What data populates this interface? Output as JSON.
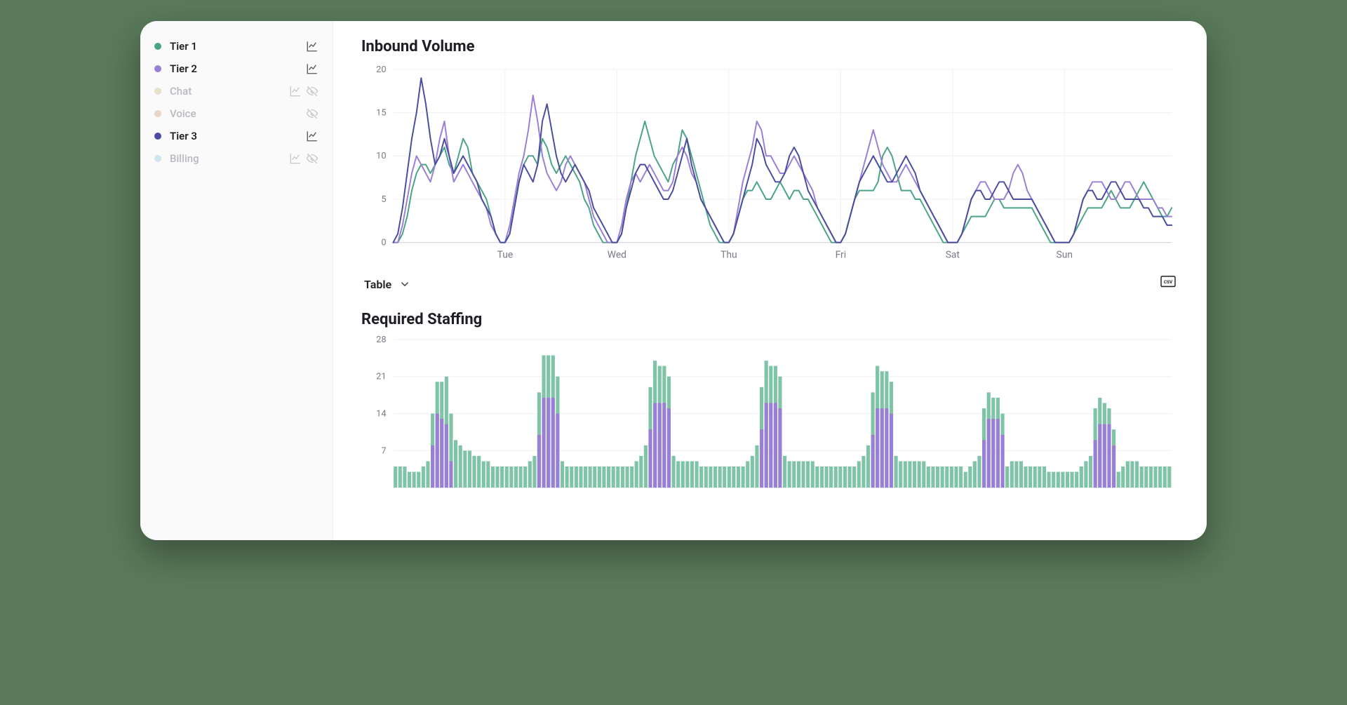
{
  "sidebar": {
    "items": [
      {
        "label": "Tier 1",
        "color": "#4aa38a",
        "active": true,
        "chart_icon": true,
        "hide_icon": false
      },
      {
        "label": "Tier 2",
        "color": "#9a7fd6",
        "active": true,
        "chart_icon": true,
        "hide_icon": false
      },
      {
        "label": "Chat",
        "color": "#e8e0c8",
        "active": false,
        "chart_icon": true,
        "hide_icon": true
      },
      {
        "label": "Voice",
        "color": "#e8d6c8",
        "active": false,
        "chart_icon": false,
        "hide_icon": true
      },
      {
        "label": "Tier 3",
        "color": "#4a4d9e",
        "active": true,
        "chart_icon": true,
        "hide_icon": false
      },
      {
        "label": "Billing",
        "color": "#cfe5ef",
        "active": false,
        "chart_icon": true,
        "hide_icon": true
      }
    ]
  },
  "toolbar": {
    "table_label": "Table"
  },
  "chart_data": [
    {
      "id": "inbound",
      "type": "line",
      "title": "Inbound Volume",
      "ylabel": "",
      "xlabel": "",
      "ylim": [
        0,
        20
      ],
      "yticks": [
        0,
        5,
        10,
        15,
        20
      ],
      "x_tick_labels": [
        "Tue",
        "Wed",
        "Thu",
        "Fri",
        "Sat",
        "Sun"
      ],
      "x_tick_positions": [
        24,
        48,
        72,
        96,
        120,
        144
      ],
      "n_points": 168,
      "series": [
        {
          "name": "Tier 1",
          "color": "#4aa38a",
          "values": [
            0,
            0,
            1,
            3,
            6,
            8,
            9,
            9,
            8,
            9,
            10,
            11,
            9,
            8,
            10,
            12,
            11,
            8,
            7,
            6,
            5,
            3,
            1,
            0,
            0,
            1,
            4,
            7,
            9,
            10,
            10,
            9,
            12,
            11,
            9,
            8,
            9,
            10,
            9,
            8,
            7,
            5,
            4,
            2,
            1,
            0,
            0,
            0,
            0,
            1,
            4,
            7,
            10,
            12,
            14,
            12,
            10,
            9,
            8,
            7,
            9,
            10,
            13,
            12,
            10,
            8,
            6,
            4,
            2,
            1,
            0,
            0,
            0,
            1,
            3,
            5,
            6,
            6,
            7,
            6,
            5,
            5,
            6,
            7,
            6,
            5,
            6,
            6,
            5,
            5,
            4,
            3,
            2,
            1,
            0,
            0,
            0,
            1,
            3,
            5,
            6,
            6,
            6,
            6,
            7,
            10,
            11,
            10,
            8,
            6,
            6,
            6,
            5,
            5,
            4,
            3,
            2,
            1,
            0,
            0,
            0,
            0,
            1,
            2,
            3,
            3,
            3,
            3,
            4,
            5,
            5,
            4,
            4,
            4,
            4,
            4,
            4,
            4,
            3,
            2,
            1,
            0,
            0,
            0,
            0,
            0,
            1,
            2,
            3,
            4,
            4,
            4,
            4,
            5,
            6,
            5,
            4,
            4,
            4,
            5,
            6,
            7,
            6,
            5,
            4,
            3,
            3,
            4
          ]
        },
        {
          "name": "Tier 2",
          "color": "#9a7fd6",
          "values": [
            0,
            0,
            2,
            5,
            8,
            10,
            9,
            8,
            7,
            9,
            12,
            14,
            10,
            7,
            8,
            9,
            8,
            7,
            6,
            5,
            4,
            2,
            1,
            0,
            0,
            2,
            5,
            8,
            10,
            13,
            17,
            14,
            10,
            8,
            7,
            6,
            7,
            9,
            10,
            9,
            8,
            7,
            5,
            3,
            2,
            1,
            0,
            0,
            0,
            2,
            5,
            7,
            8,
            7,
            8,
            9,
            8,
            7,
            6,
            6,
            7,
            10,
            11,
            10,
            8,
            7,
            5,
            4,
            3,
            2,
            1,
            0,
            0,
            1,
            4,
            7,
            9,
            11,
            14,
            13,
            10,
            10,
            9,
            8,
            8,
            9,
            10,
            9,
            8,
            7,
            6,
            4,
            3,
            2,
            1,
            0,
            0,
            1,
            3,
            5,
            7,
            9,
            11,
            13,
            11,
            9,
            8,
            7,
            7,
            8,
            9,
            8,
            7,
            6,
            5,
            4,
            3,
            2,
            1,
            0,
            0,
            0,
            1,
            3,
            5,
            6,
            7,
            7,
            6,
            5,
            5,
            5,
            6,
            8,
            9,
            8,
            6,
            5,
            4,
            3,
            2,
            1,
            0,
            0,
            0,
            0,
            1,
            3,
            5,
            6,
            7,
            7,
            7,
            6,
            5,
            5,
            6,
            7,
            7,
            6,
            5,
            5,
            5,
            5,
            4,
            4,
            3,
            3
          ]
        },
        {
          "name": "Tier 3",
          "color": "#4a4d9e",
          "values": [
            0,
            1,
            4,
            8,
            12,
            15,
            19,
            16,
            12,
            9,
            10,
            12,
            10,
            8,
            9,
            10,
            9,
            8,
            7,
            5,
            4,
            3,
            1,
            0,
            0,
            1,
            4,
            7,
            9,
            8,
            7,
            9,
            14,
            16,
            13,
            10,
            8,
            7,
            8,
            9,
            8,
            7,
            6,
            4,
            3,
            2,
            1,
            0,
            0,
            1,
            4,
            6,
            8,
            9,
            9,
            8,
            7,
            6,
            5,
            5,
            6,
            8,
            10,
            12,
            9,
            7,
            5,
            4,
            3,
            2,
            1,
            0,
            0,
            1,
            3,
            5,
            7,
            9,
            12,
            11,
            9,
            8,
            7,
            7,
            8,
            10,
            11,
            10,
            8,
            6,
            5,
            4,
            3,
            2,
            1,
            0,
            0,
            1,
            3,
            5,
            7,
            8,
            9,
            10,
            9,
            8,
            7,
            7,
            8,
            9,
            10,
            9,
            8,
            6,
            5,
            4,
            3,
            2,
            1,
            0,
            0,
            0,
            1,
            3,
            5,
            6,
            6,
            5,
            5,
            6,
            7,
            7,
            6,
            5,
            5,
            5,
            5,
            5,
            4,
            3,
            2,
            1,
            0,
            0,
            0,
            0,
            1,
            3,
            5,
            6,
            6,
            5,
            5,
            6,
            7,
            7,
            6,
            5,
            5,
            5,
            5,
            4,
            4,
            3,
            3,
            3,
            2,
            2
          ]
        }
      ]
    },
    {
      "id": "staffing",
      "type": "bar",
      "title": "Required Staffing",
      "ylabel": "",
      "xlabel": "",
      "ylim": [
        0,
        28
      ],
      "yticks": [
        7,
        14,
        21,
        28
      ],
      "n_points": 168,
      "series": [
        {
          "name": "Tier 1",
          "color": "#7fc4a6",
          "values": [
            4,
            4,
            4,
            3,
            3,
            3,
            4,
            5,
            6,
            6,
            7,
            9,
            9,
            9,
            8,
            7,
            7,
            6,
            6,
            5,
            5,
            4,
            4,
            4,
            4,
            4,
            4,
            4,
            4,
            5,
            6,
            8,
            8,
            8,
            8,
            7,
            5,
            4,
            4,
            4,
            4,
            4,
            4,
            4,
            4,
            4,
            4,
            4,
            4,
            4,
            4,
            4,
            5,
            6,
            8,
            8,
            8,
            7,
            7,
            6,
            6,
            5,
            5,
            5,
            5,
            5,
            4,
            4,
            4,
            4,
            4,
            4,
            4,
            4,
            4,
            4,
            5,
            6,
            8,
            8,
            8,
            7,
            7,
            6,
            6,
            5,
            5,
            5,
            5,
            5,
            5,
            4,
            4,
            4,
            4,
            4,
            4,
            4,
            4,
            4,
            5,
            6,
            8,
            8,
            8,
            7,
            7,
            6,
            6,
            5,
            5,
            5,
            5,
            5,
            5,
            4,
            4,
            4,
            4,
            4,
            4,
            4,
            4,
            3,
            4,
            5,
            6,
            6,
            5,
            4,
            4,
            4,
            4,
            5,
            5,
            5,
            4,
            4,
            4,
            4,
            4,
            3,
            3,
            3,
            3,
            3,
            3,
            3,
            4,
            5,
            6,
            6,
            5,
            4,
            3,
            3,
            3,
            4,
            5,
            5,
            5,
            4,
            4,
            4,
            4,
            4,
            4,
            4
          ]
        },
        {
          "name": "Tier 2",
          "color": "#9a7fd6",
          "values": [
            0,
            0,
            0,
            0,
            0,
            0,
            0,
            0,
            8,
            14,
            13,
            12,
            5,
            0,
            0,
            0,
            0,
            0,
            0,
            0,
            0,
            0,
            0,
            0,
            0,
            0,
            0,
            0,
            0,
            0,
            0,
            10,
            17,
            17,
            17,
            14,
            0,
            0,
            0,
            0,
            0,
            0,
            0,
            0,
            0,
            0,
            0,
            0,
            0,
            0,
            0,
            0,
            0,
            0,
            0,
            11,
            16,
            16,
            16,
            15,
            0,
            0,
            0,
            0,
            0,
            0,
            0,
            0,
            0,
            0,
            0,
            0,
            0,
            0,
            0,
            0,
            0,
            0,
            0,
            11,
            16,
            16,
            16,
            15,
            0,
            0,
            0,
            0,
            0,
            0,
            0,
            0,
            0,
            0,
            0,
            0,
            0,
            0,
            0,
            0,
            0,
            0,
            0,
            10,
            15,
            15,
            15,
            14,
            0,
            0,
            0,
            0,
            0,
            0,
            0,
            0,
            0,
            0,
            0,
            0,
            0,
            0,
            0,
            0,
            0,
            0,
            0,
            9,
            13,
            13,
            13,
            10,
            0,
            0,
            0,
            0,
            0,
            0,
            0,
            0,
            0,
            0,
            0,
            0,
            0,
            0,
            0,
            0,
            0,
            0,
            0,
            9,
            12,
            12,
            12,
            8,
            0,
            0,
            0,
            0,
            0,
            0,
            0,
            0,
            0,
            0,
            0,
            0
          ]
        }
      ]
    }
  ]
}
